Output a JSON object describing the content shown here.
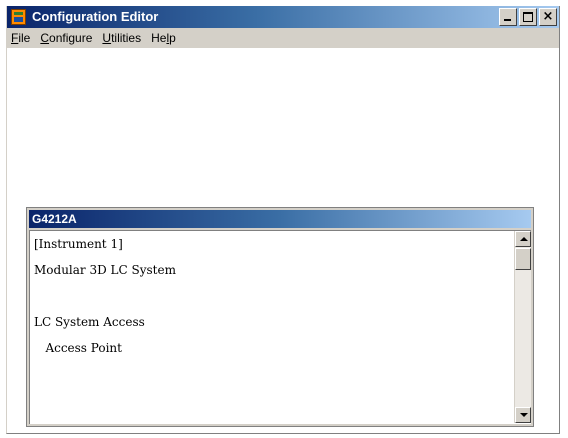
{
  "window": {
    "title": "Configuration Editor",
    "icon": "app-icon",
    "controls": {
      "minimize": "minimize-icon",
      "maximize": "maximize-icon",
      "close_glyph": "×"
    }
  },
  "menubar": {
    "items": [
      {
        "mnemonic": "F",
        "rest": "ile"
      },
      {
        "mnemonic": "C",
        "rest": "onfigure"
      },
      {
        "mnemonic": "U",
        "rest": "tilities"
      },
      {
        "pre": "He",
        "mnemonic": "l",
        "rest": "p"
      }
    ]
  },
  "child_window": {
    "title": "G4212A",
    "lines": [
      "[Instrument 1]",
      "Modular 3D LC System",
      "",
      "LC System Access",
      "   Access Point"
    ]
  },
  "colors": {
    "titlebar_start": "#0a246a",
    "titlebar_end": "#a6caf0",
    "chrome": "#d4d0c8"
  }
}
